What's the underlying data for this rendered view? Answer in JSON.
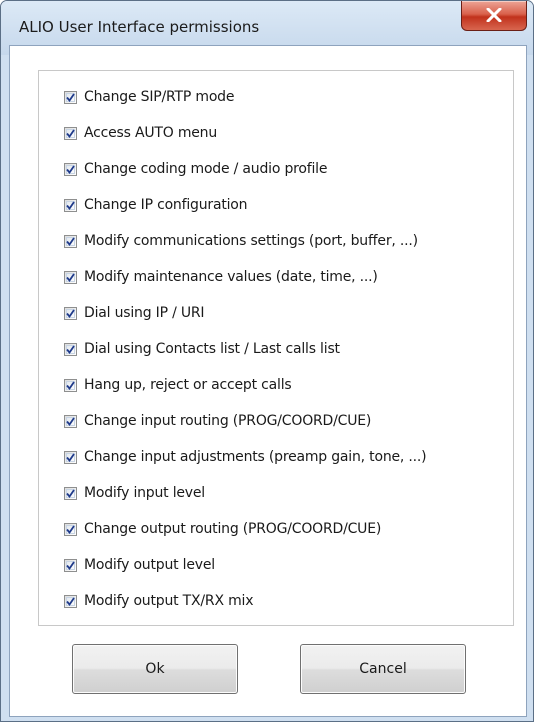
{
  "window": {
    "title": "ALIO User Interface permissions",
    "close_icon": "close-icon"
  },
  "permissions": [
    {
      "label": "Change SIP/RTP mode",
      "checked": true
    },
    {
      "label": "Access AUTO menu",
      "checked": true
    },
    {
      "label": "Change coding mode / audio profile",
      "checked": true
    },
    {
      "label": "Change IP configuration",
      "checked": true
    },
    {
      "label": "Modify communications settings (port, buffer, ...)",
      "checked": true
    },
    {
      "label": "Modify maintenance values (date, time, ...)",
      "checked": true
    },
    {
      "label": "Dial using IP / URI",
      "checked": true
    },
    {
      "label": "Dial using Contacts list / Last calls list",
      "checked": true
    },
    {
      "label": "Hang up, reject or accept calls",
      "checked": true
    },
    {
      "label": "Change input routing (PROG/COORD/CUE)",
      "checked": true
    },
    {
      "label": "Change input adjustments (preamp gain, tone, ...)",
      "checked": true
    },
    {
      "label": "Modify input level",
      "checked": true
    },
    {
      "label": "Change output routing (PROG/COORD/CUE)",
      "checked": true
    },
    {
      "label": "Modify output level",
      "checked": true
    },
    {
      "label": "Modify output TX/RX mix",
      "checked": true
    }
  ],
  "buttons": {
    "ok_label": "Ok",
    "cancel_label": "Cancel"
  },
  "colors": {
    "title_bar": "#c6d8ec",
    "close_button": "#c1321c",
    "checkmark": "#1f3a8a"
  }
}
